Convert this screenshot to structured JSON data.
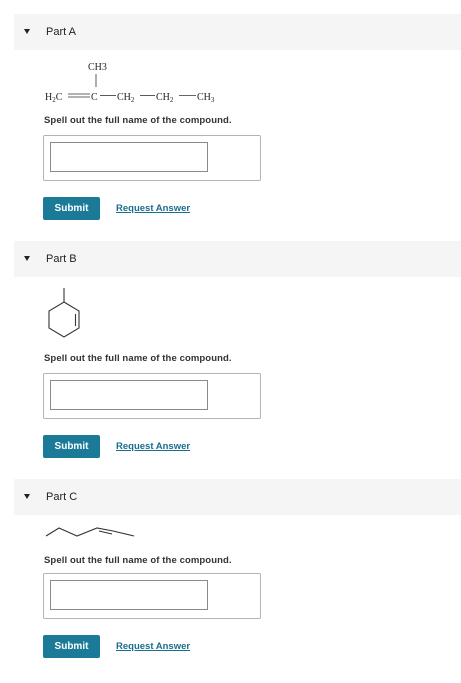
{
  "parts": [
    {
      "title": "Part A",
      "prompt": "Spell out the full name of the compound.",
      "structure": {
        "top_group": "CH3",
        "main_chain": [
          "H2C",
          "C",
          "CH2",
          "CH2",
          "CH3"
        ]
      },
      "answer_value": "",
      "submit_label": "Submit",
      "request_label": "Request Answer"
    },
    {
      "title": "Part B",
      "prompt": "Spell out the full name of the compound.",
      "answer_value": "",
      "submit_label": "Submit",
      "request_label": "Request Answer"
    },
    {
      "title": "Part C",
      "prompt": "Spell out the full name of the compound.",
      "answer_value": "",
      "submit_label": "Submit",
      "request_label": "Request Answer"
    }
  ]
}
